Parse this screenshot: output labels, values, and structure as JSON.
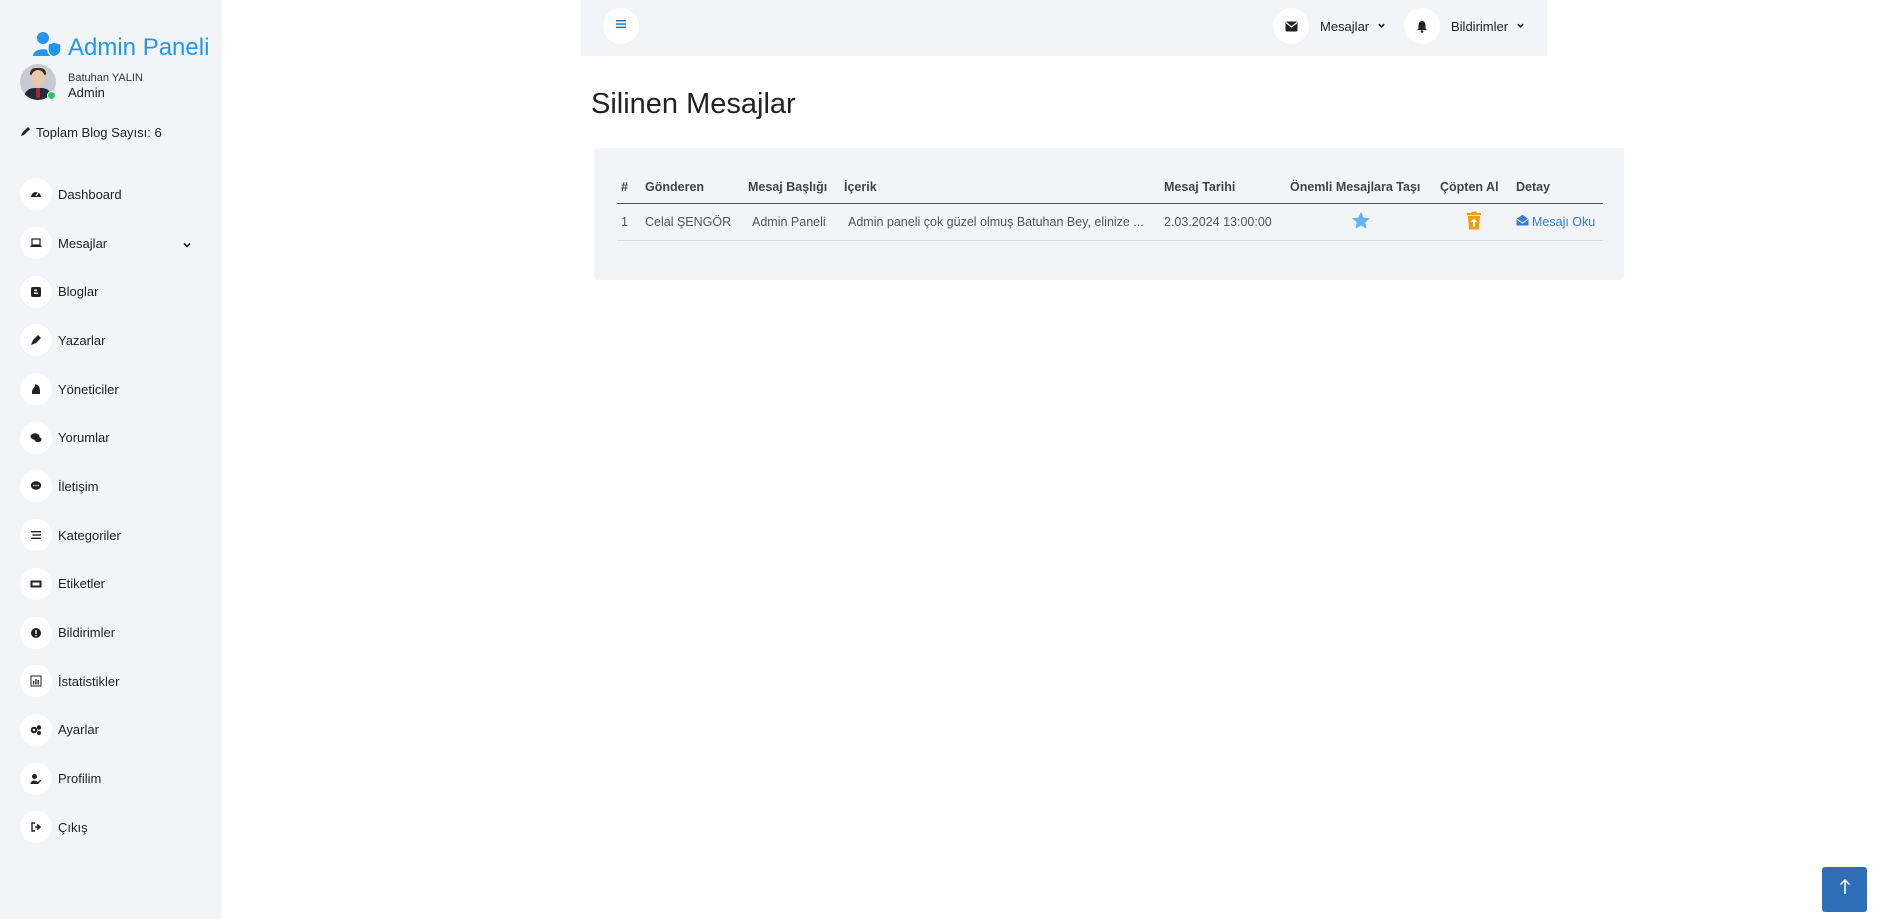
{
  "sidebar": {
    "brand": "Admin Paneli",
    "user_name": "Batuhan YALIN",
    "user_role": "Admin",
    "blog_count": "Toplam Blog Sayısı: 6",
    "items": [
      {
        "label": "Dashboard",
        "icon": "dashboard-icon"
      },
      {
        "label": "Mesajlar",
        "icon": "laptop-icon"
      },
      {
        "label": "Bloglar",
        "icon": "blogger-icon"
      },
      {
        "label": "Yazarlar",
        "icon": "pen-icon"
      },
      {
        "label": "Yöneticiler",
        "icon": "chess-knight-icon"
      },
      {
        "label": "Yorumlar",
        "icon": "comments-icon"
      },
      {
        "label": "İletişim",
        "icon": "message-icon"
      },
      {
        "label": "Kategoriler",
        "icon": "list-icon"
      },
      {
        "label": "Etiketler",
        "icon": "tag-icon"
      },
      {
        "label": "Bildirimler",
        "icon": "alert-icon"
      },
      {
        "label": "İstatistikler",
        "icon": "chart-icon"
      },
      {
        "label": "Ayarlar",
        "icon": "gears-icon"
      },
      {
        "label": "Profilim",
        "icon": "user-edit-icon"
      },
      {
        "label": "Çıkış",
        "icon": "sign-out-icon"
      }
    ]
  },
  "topbar": {
    "messages_label": "Mesajlar",
    "notifications_label": "Bildirimler"
  },
  "page": {
    "title": "Silinen Mesajlar"
  },
  "table": {
    "headers": [
      "#",
      "Gönderen",
      "Mesaj Başlığı",
      "İçerik",
      "Mesaj Tarihi",
      "Önemli Mesajlara Taşı",
      "Çöpten Al",
      "Detay"
    ],
    "rows": [
      {
        "num": "1",
        "sender": "Celal ŞENGÖR",
        "subject": "Admin Paneli",
        "content": "Admin paneli çok güzel olmuş Batuhan Bey, elinize ...",
        "date": "2.03.2024 13:00:00",
        "detail_label": "Mesajı Oku"
      }
    ]
  },
  "colors": {
    "brand": "#2196f3",
    "star": "#64b5f6",
    "restore": "#f39c12",
    "link": "#3a7bd5",
    "scroll_top": "#2d6fb6"
  }
}
